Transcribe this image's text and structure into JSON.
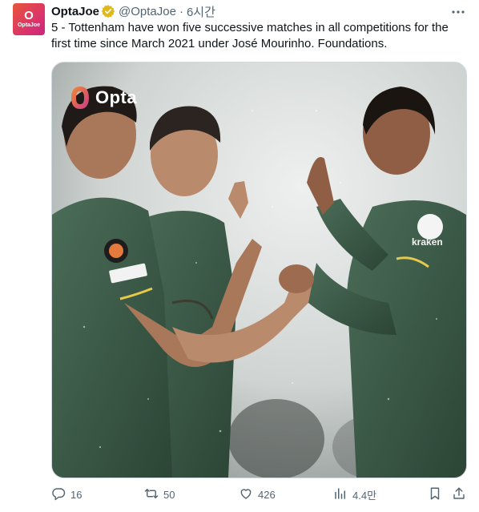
{
  "author": {
    "display_name": "OptaJoe",
    "handle": "@OptaJoe",
    "separator": "·",
    "time": "6시간",
    "avatar_mark": "O",
    "avatar_text": "OptaJoe"
  },
  "tweet": {
    "text": "5 - Tottenham have won five successive matches in all competitions for the first time since March 2021 under José Mourinho. Foundations."
  },
  "media": {
    "watermark": "Opta",
    "sponsor": "kraken"
  },
  "actions": {
    "replies": "16",
    "retweets": "50",
    "likes": "426",
    "views": "4.4만"
  },
  "colors": {
    "verified": "#e2b719",
    "muted": "#536471",
    "kit_green": "#3c5a48",
    "brand_gradient_start": "#e8563a",
    "brand_gradient_end": "#c8267f"
  },
  "icons": [
    "verified-badge-icon",
    "more-icon",
    "reply-icon",
    "retweet-icon",
    "like-icon",
    "views-icon",
    "bookmark-icon",
    "share-icon"
  ]
}
